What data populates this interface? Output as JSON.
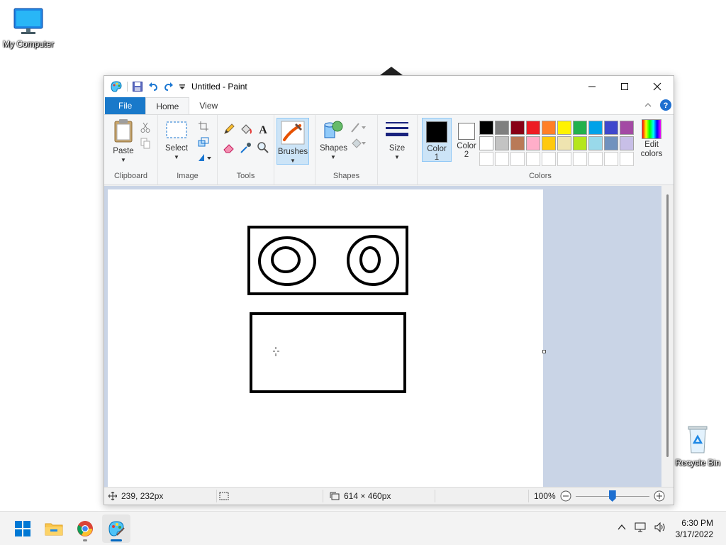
{
  "desktop": {
    "icons": [
      {
        "label": "My Computer"
      },
      {
        "label": "Recycle Bin"
      }
    ]
  },
  "window": {
    "title": "Untitled - Paint",
    "tabs": {
      "file": "File",
      "home": "Home",
      "view": "View"
    },
    "ribbon": {
      "clipboard": {
        "paste": "Paste",
        "group": "Clipboard"
      },
      "image": {
        "select": "Select",
        "group": "Image"
      },
      "tools": {
        "group": "Tools"
      },
      "brushes": "Brushes",
      "shapes": {
        "label": "Shapes",
        "group": "Shapes"
      },
      "size": "Size",
      "color1": {
        "line1": "Color",
        "line2": "1"
      },
      "color2": {
        "line1": "Color",
        "line2": "2"
      },
      "colors_group": "Colors",
      "edit_colors": {
        "line1": "Edit",
        "line2": "colors"
      },
      "palette": [
        "#000000",
        "#7f7f7f",
        "#880015",
        "#ed1c24",
        "#ff7f27",
        "#fff200",
        "#22b14c",
        "#00a2e8",
        "#3f48cc",
        "#a349a4",
        "#ffffff",
        "#c3c3c3",
        "#b97a57",
        "#ffaec9",
        "#ffc90e",
        "#efe4b0",
        "#b5e61d",
        "#99d9ea",
        "#7092be",
        "#c8bfe7",
        "#ffffff",
        "#ffffff",
        "#ffffff",
        "#ffffff",
        "#ffffff",
        "#ffffff",
        "#ffffff",
        "#ffffff",
        "#ffffff",
        "#ffffff"
      ],
      "color1_value": "#000000",
      "color2_value": "#ffffff"
    },
    "status": {
      "cursor": "239, 232px",
      "canvas_size": "614 × 460px",
      "zoom": "100%",
      "zoom_level": 0.5
    }
  },
  "taskbar": {
    "time": "6:30 PM",
    "date": "3/17/2022"
  }
}
